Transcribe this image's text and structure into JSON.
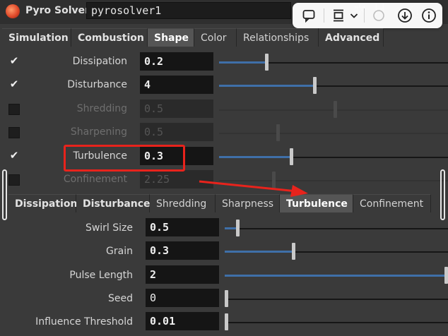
{
  "header": {
    "node_type": "Pyro Solver",
    "node_name": "pyrosolver1"
  },
  "overlay_toolbar": {
    "icons": [
      "comment-icon",
      "screen-icon",
      "chevron-down-icon",
      "download-icon",
      "info-icon"
    ]
  },
  "top_tabs": [
    {
      "label": "Simulation"
    },
    {
      "label": "Combustion"
    },
    {
      "label": "Shape"
    },
    {
      "label": "Color"
    },
    {
      "label": "Relationships"
    },
    {
      "label": "Advanced"
    }
  ],
  "shape_params": [
    {
      "label": "Dissipation",
      "value": "0.2",
      "checked": true,
      "enabled": true,
      "slider": 0.2
    },
    {
      "label": "Disturbance",
      "value": "4",
      "checked": true,
      "enabled": true,
      "slider": 0.41
    },
    {
      "label": "Shredding",
      "value": "0.5",
      "checked": false,
      "enabled": false,
      "slider": 0.5
    },
    {
      "label": "Sharpening",
      "value": "0.5",
      "checked": false,
      "enabled": false,
      "slider": 0.25
    },
    {
      "label": "Turbulence",
      "value": "0.3",
      "checked": true,
      "enabled": true,
      "slider": 0.31
    },
    {
      "label": "Confinement",
      "value": "2.25",
      "checked": false,
      "enabled": false,
      "slider": 0.23
    }
  ],
  "sub_tabs": [
    {
      "label": "Dissipation"
    },
    {
      "label": "Disturbance"
    },
    {
      "label": "Shredding"
    },
    {
      "label": "Sharpness"
    },
    {
      "label": "Turbulence"
    },
    {
      "label": "Confinement"
    }
  ],
  "turbulence_params": [
    {
      "label": "Swirl Size",
      "value": "0.5",
      "slider": 0.05
    },
    {
      "label": "Grain",
      "value": "0.3",
      "slider": 0.3
    },
    {
      "label": "Pulse Length",
      "value": "2",
      "slider": 1.0
    },
    {
      "label": "Seed",
      "value": "0",
      "slider": 0.0
    },
    {
      "label": "Influence Threshold",
      "value": "0.01",
      "slider": 0.0
    }
  ],
  "colors": {
    "annotation": "#e8231c",
    "slider_fill": "#3f6fa8"
  }
}
